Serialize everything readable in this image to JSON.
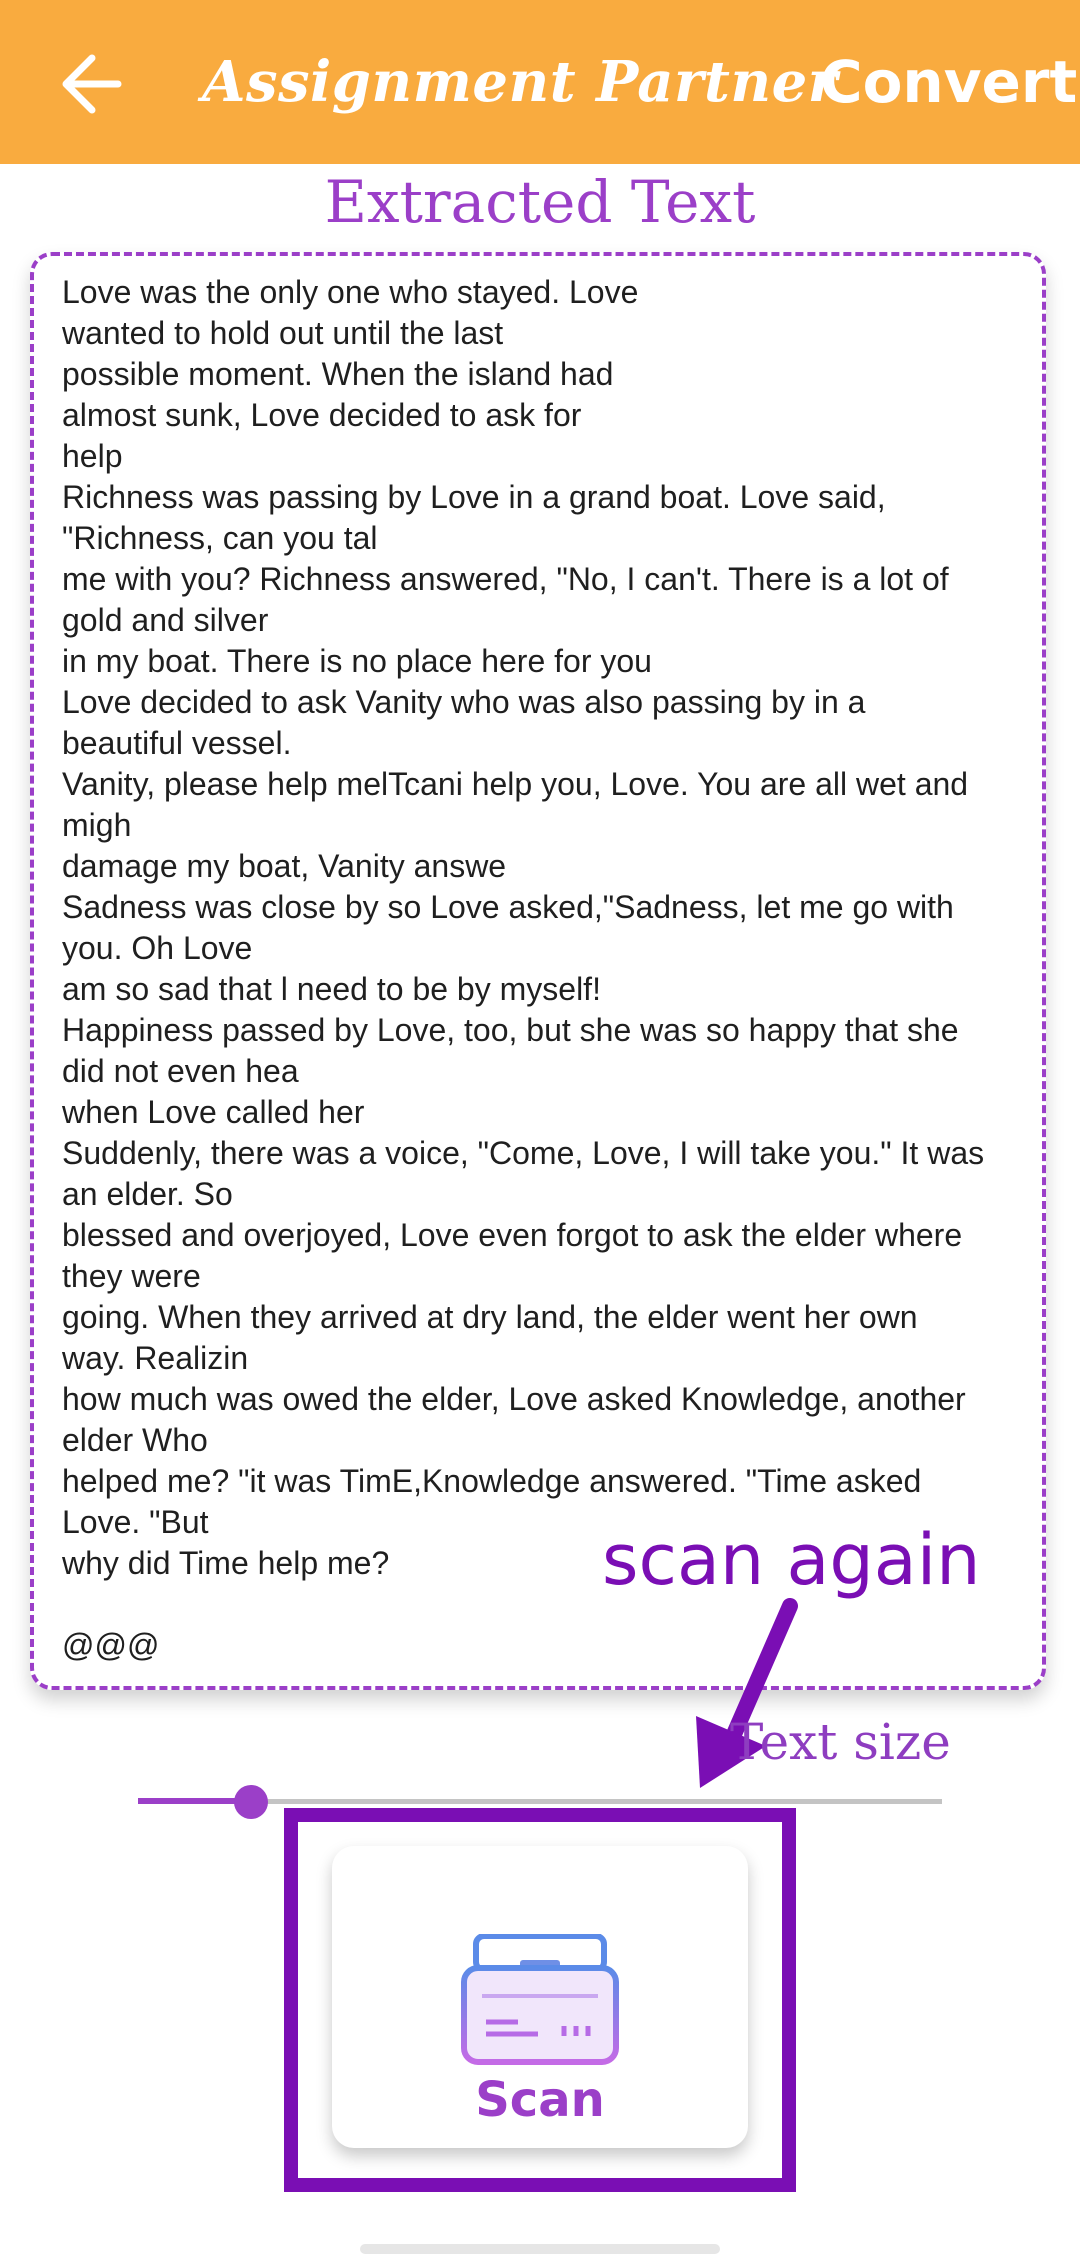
{
  "header": {
    "title": "Assignment Partner",
    "convert_label": "Convert",
    "background_color": "#F9AB3F",
    "back_icon": "arrow-left-icon"
  },
  "section_title": "Extracted Text",
  "extracted_text": "Love was the only one who stayed. Love\nwanted to hold out until the last\npossible moment. When the island had\nalmost sunk, Love decided to ask for\nhelp\nRichness was passing by Love in a grand boat. Love said,\n\"Richness, can you tal\nme with you? Richness answered, \"No, I can't. There is a lot of\ngold and silver\nin my boat. There is no place here for you\nLove decided to ask Vanity who was also passing by in a\nbeautiful vessel.\nVanity, please help melTcani help you, Love. You are all wet and\nmigh\ndamage my boat, Vanity answe\nSadness was close by so Love asked,\"Sadness, let me go with\nyou. Oh Love\nam so sad that l need to be by myself!\nHappiness passed by Love, too, but she was so happy that she\ndid not even hea\nwhen Love called her\nSuddenly, there was a voice, \"Come, Love, I will take you.\" It was\nan elder. So\nblessed and overjoyed, Love even forgot to ask the elder where\nthey were\ngoing. When they arrived at dry land, the elder went her own\nway. Realizin\nhow much was owed the elder, Love asked Knowledge, another\nelder Who\nhelped me? \"it was TimE,Knowledge answered. \"Time asked\nLove. \"But\nwhy did Time help me?\n\n@@@",
  "annotation": {
    "text": "scan again",
    "color": "#7A0EB4"
  },
  "text_size": {
    "label": "Text size",
    "value_fraction": 0.14
  },
  "scan_button": {
    "label": "Scan",
    "icon": "scanner-icon"
  },
  "accent_color": "#9B3FC8"
}
